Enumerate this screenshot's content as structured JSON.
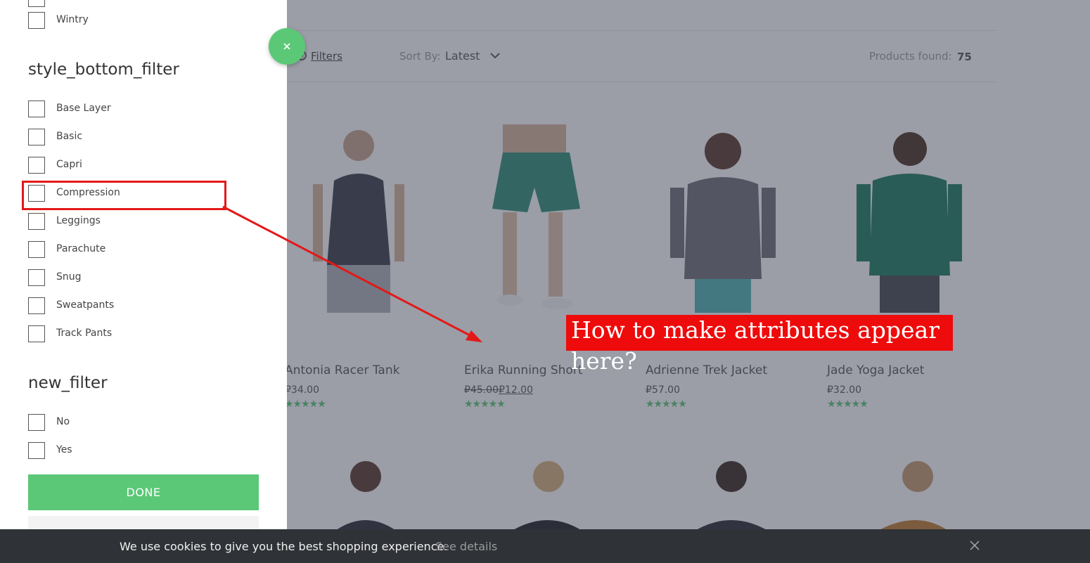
{
  "toolbar": {
    "filters_label": "Filters",
    "sort_label": "Sort By:",
    "sort_value": "Latest",
    "products_found_label": "Products found:",
    "products_found_count": "75"
  },
  "products": [
    {
      "name": "Antonia Racer Tank",
      "price": "₽34.00",
      "rating_stars": "★★★★★"
    },
    {
      "name": "Erika Running Short",
      "old_price": "₽45.00",
      "price": "₽12.00",
      "rating_stars": "★★★★★"
    },
    {
      "name": "Adrienne Trek Jacket",
      "price": "₽57.00",
      "rating_stars": "★★★★★"
    },
    {
      "name": "Jade Yoga Jacket",
      "price": "₽32.00",
      "rating_stars": "★★★★★"
    }
  ],
  "filter_panel": {
    "top_partial_item": "Wintry",
    "groups": [
      {
        "title": "style_bottom_filter",
        "options": [
          "Base Layer",
          "Basic",
          "Capri",
          "Compression",
          "Leggings",
          "Parachute",
          "Snug",
          "Sweatpants",
          "Track Pants"
        ]
      },
      {
        "title": "new_filter",
        "options": [
          "No",
          "Yes"
        ]
      }
    ],
    "done_label": "DONE"
  },
  "annotation": {
    "text": "How to make attributes appear here?",
    "color": "#ee0b0b"
  },
  "cookie_bar": {
    "message": "We use cookies to give you the best shopping experience.",
    "details_link": "See details"
  },
  "colors": {
    "accent": "#5bc877",
    "cookie_bg": "#2f3236"
  }
}
